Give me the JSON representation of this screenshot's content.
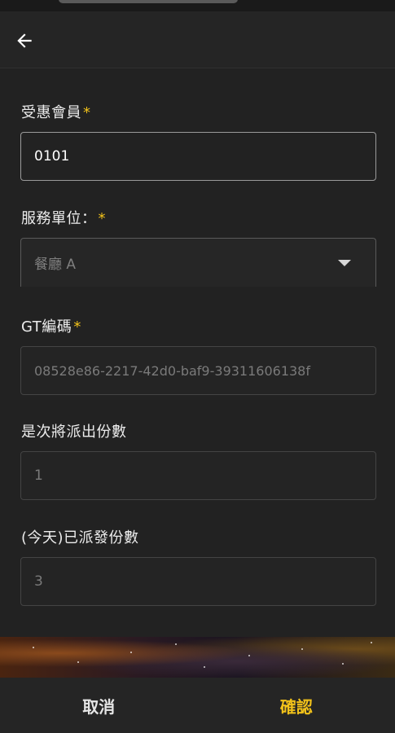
{
  "form": {
    "member": {
      "label": "受惠會員",
      "required_mark": "*",
      "value": "0101"
    },
    "unit": {
      "label": "服務單位：",
      "required_mark": "*",
      "value": "餐廳 A"
    },
    "gt_code": {
      "label": "GT編碼",
      "required_mark": "*",
      "value": "08528e86-2217-42d0-baf9-39311606138f"
    },
    "quantity": {
      "label": "是次將派出份數",
      "value": "1"
    },
    "today_sent": {
      "label": "(今天)已派發份數",
      "value": "3"
    }
  },
  "actions": {
    "cancel_label": "取消",
    "confirm_label": "確認"
  },
  "colors": {
    "accent": "#f2c21a",
    "background": "#222222"
  },
  "icons": {
    "back": "arrow-left-icon",
    "dropdown": "caret-down-icon"
  }
}
